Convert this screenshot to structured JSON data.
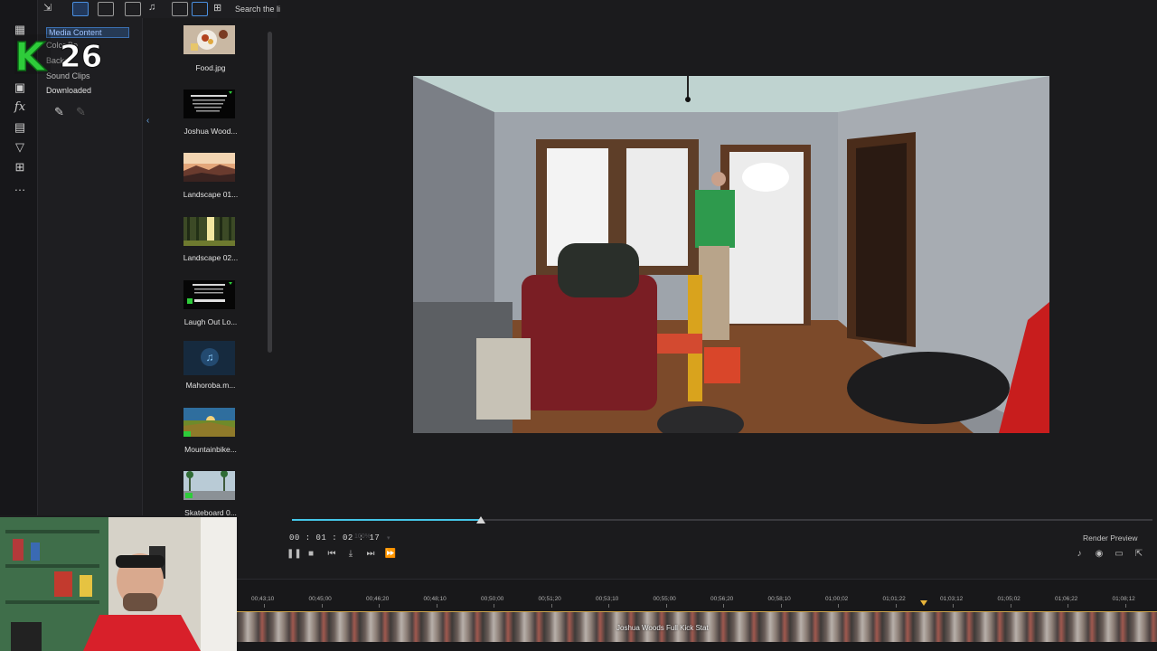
{
  "toolbar": {
    "search_placeholder": "Search the li"
  },
  "categories": {
    "items": [
      "Media Content",
      "Color Bo",
      "Backgr",
      "Sound Clips",
      "Downloaded"
    ]
  },
  "media": {
    "items": [
      {
        "label": "Food.jpg",
        "kind": "image"
      },
      {
        "label": "Joshua Wood...",
        "kind": "text-card"
      },
      {
        "label": "Landscape 01...",
        "kind": "image"
      },
      {
        "label": "Landscape 02...",
        "kind": "image"
      },
      {
        "label": "Laugh Out Lo...",
        "kind": "text-card"
      },
      {
        "label": "Mahoroba.m...",
        "kind": "audio"
      },
      {
        "label": "Mountainbike...",
        "kind": "image"
      },
      {
        "label": "Skateboard 0...",
        "kind": "image"
      }
    ]
  },
  "logo": {
    "letter": "K",
    "number": "26",
    "color": "#2ecc3a"
  },
  "playback": {
    "timecode": "00 : 01 : 02 : 17",
    "zoom_dim": "100%",
    "progress_fraction": 0.22,
    "render_preview_label": "Render Preview",
    "accent": "#45c6e8"
  },
  "timeline": {
    "ticks": [
      "00;43;10",
      "00;45;00",
      "00;46;20",
      "00;48;10",
      "00;50;00",
      "00;51;20",
      "00;53;10",
      "00;55;00",
      "00;56;20",
      "00;58;10",
      "01;00;02",
      "01;01;22",
      "01;03;12",
      "01;05;02",
      "01;06;22",
      "01;08;12"
    ],
    "clip_label": "Joshua Woods Full Kick Stat",
    "playhead_color": "#e8b43a"
  }
}
